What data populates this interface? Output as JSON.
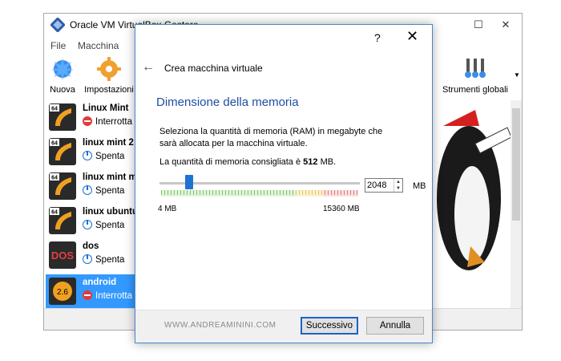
{
  "main_window": {
    "title": "Oracle VM VirtualBox Gestore",
    "menu": {
      "file": "File",
      "machine": "Macchina"
    },
    "toolbar": {
      "new": "Nuova",
      "settings": "Impostazioni",
      "global_tools": "Strumenti globali"
    },
    "vms": [
      {
        "name": "Linux Mint",
        "status": "Interrotta",
        "state": "stopped",
        "badge": "64"
      },
      {
        "name": "linux mint 2",
        "status": "Spenta",
        "state": "off",
        "badge": "64"
      },
      {
        "name": "linux mint m",
        "status": "Spenta",
        "state": "off",
        "badge": "64"
      },
      {
        "name": "linux ubuntu",
        "status": "Spenta",
        "state": "off",
        "badge": "64"
      },
      {
        "name": "dos",
        "status": "Spenta",
        "state": "off",
        "badge": "DOS"
      },
      {
        "name": "android",
        "status": "Interrotta",
        "state": "stopped",
        "badge": "2.6"
      }
    ],
    "selected_vm": "android"
  },
  "dialog": {
    "help": "?",
    "close": "✕",
    "back": "←",
    "heading": "Crea macchina virtuale",
    "section_title": "Dimensione della memoria",
    "description": "Seleziona la quantità di memoria (RAM) in megabyte che sarà allocata per la macchina virtuale.",
    "recommended_prefix": "La quantità di memoria consigliata è ",
    "recommended_value": "512",
    "recommended_suffix": " MB.",
    "memory_value": "2048",
    "memory_unit": "MB",
    "slider_level": 0.133,
    "range_min": "4 MB",
    "range_max": "15360 MB",
    "watermark": "WWW.ANDREAMININI.COM",
    "next_label": "Successivo",
    "cancel_label": "Annulla"
  },
  "colors": {
    "accent": "#1f4ea3",
    "selection": "#3399ff",
    "slider_handle": "#1e73d0"
  }
}
